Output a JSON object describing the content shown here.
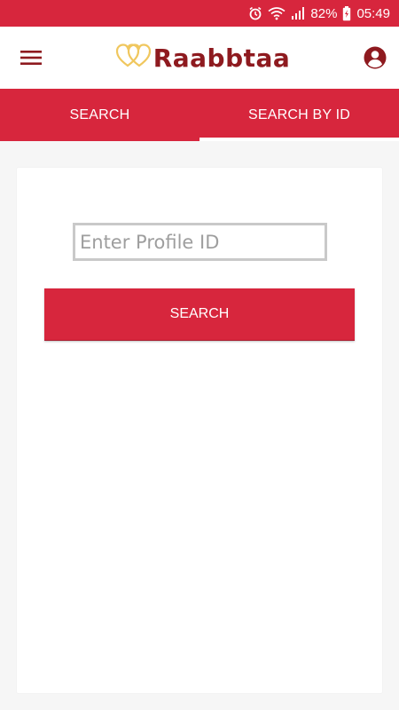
{
  "status_bar": {
    "battery": "82%",
    "time": "05:49",
    "icons": [
      "alarm-icon",
      "wifi-icon",
      "signal-icon",
      "battery-charging-icon"
    ]
  },
  "app_bar": {
    "brand": "Raabbtaa",
    "icons": [
      "menu-icon",
      "hearts-logo-icon",
      "account-icon"
    ]
  },
  "tabs": [
    {
      "label": "SEARCH",
      "active": false
    },
    {
      "label": "SEARCH BY ID",
      "active": true
    }
  ],
  "form": {
    "profile_id_placeholder": "Enter Profile ID",
    "profile_id_value": "",
    "search_label": "SEARCH"
  },
  "colors": {
    "primary": "#d7263d",
    "brand_text": "#8e1a1f",
    "logo_gold": "#f0c75e",
    "background": "#f6f6f6"
  }
}
